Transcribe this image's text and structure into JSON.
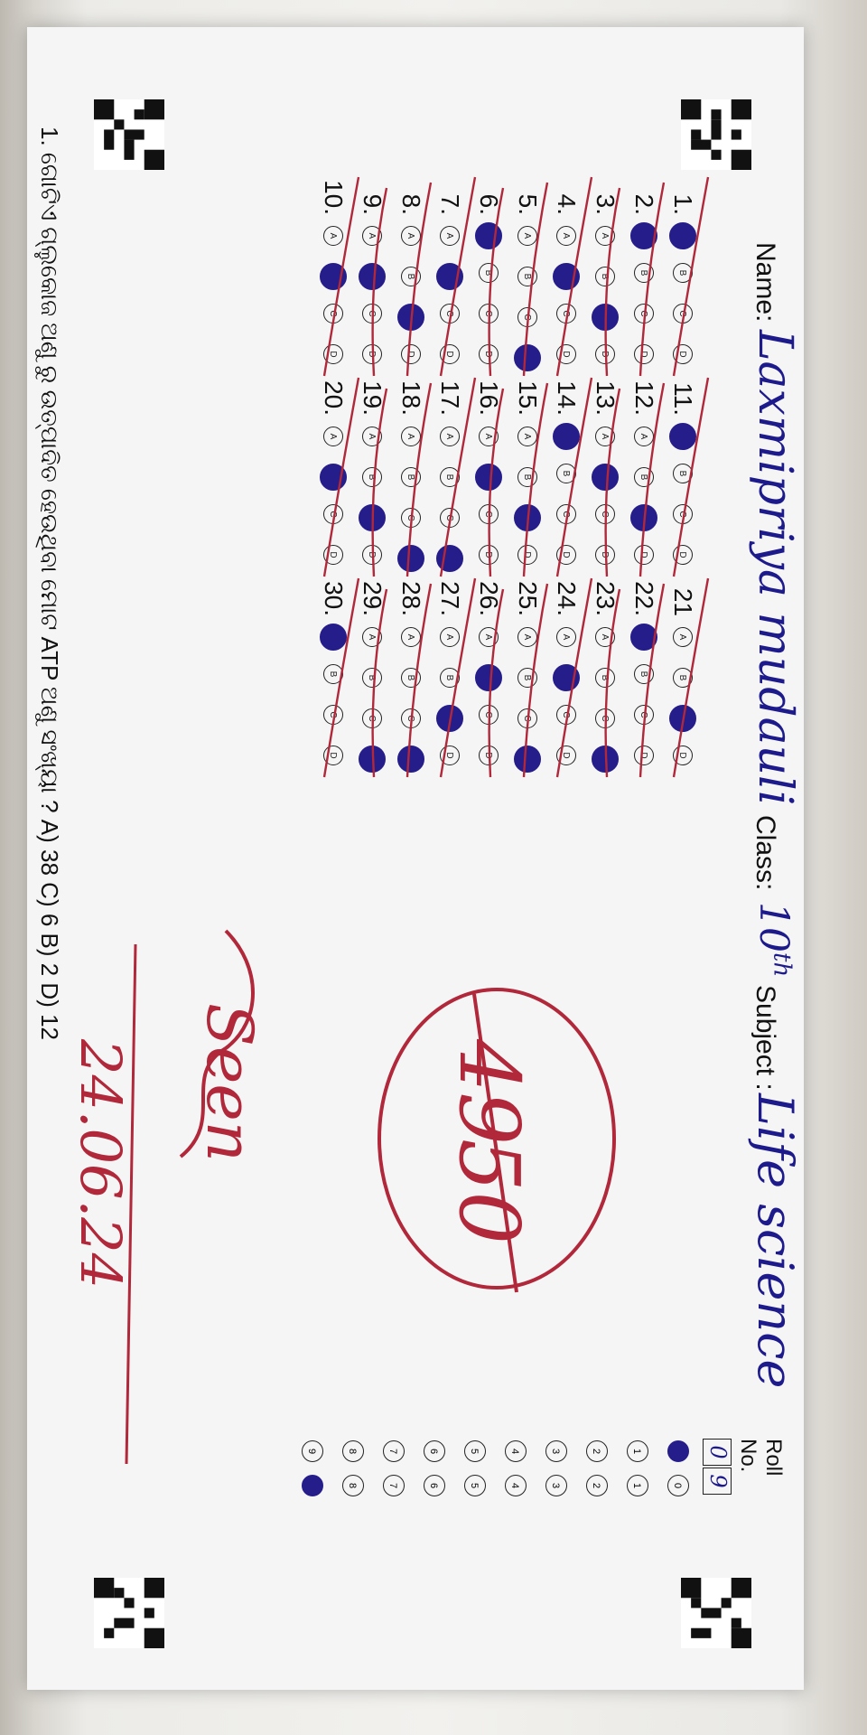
{
  "header": {
    "name_label": "Name:",
    "name_value": "Laxmipriya mudauli",
    "class_label": "Class:",
    "class_value": "10",
    "class_sup": "th",
    "subject_label": "Subject :",
    "subject_value": "Life science",
    "roll_label": "Roll No."
  },
  "roll_number": [
    "0",
    "9"
  ],
  "roll_digits": [
    "0",
    "1",
    "2",
    "3",
    "4",
    "5",
    "6",
    "7",
    "8",
    "9"
  ],
  "options": [
    "A",
    "B",
    "C",
    "D"
  ],
  "answers": [
    {
      "q": "1.",
      "filled": "A"
    },
    {
      "q": "2.",
      "filled": "A"
    },
    {
      "q": "3.",
      "filled": "C"
    },
    {
      "q": "4.",
      "filled": "B"
    },
    {
      "q": "5.",
      "filled": "D"
    },
    {
      "q": "6.",
      "filled": "A"
    },
    {
      "q": "7.",
      "filled": "B"
    },
    {
      "q": "8.",
      "filled": "C"
    },
    {
      "q": "9.",
      "filled": "B"
    },
    {
      "q": "10.",
      "filled": "B"
    },
    {
      "q": "11.",
      "filled": "A"
    },
    {
      "q": "12.",
      "filled": "C"
    },
    {
      "q": "13.",
      "filled": "B"
    },
    {
      "q": "14.",
      "filled": "A"
    },
    {
      "q": "15.",
      "filled": "C"
    },
    {
      "q": "16.",
      "filled": "B"
    },
    {
      "q": "17.",
      "filled": "D"
    },
    {
      "q": "18.",
      "filled": "D"
    },
    {
      "q": "19.",
      "filled": "C"
    },
    {
      "q": "20.",
      "filled": "B"
    },
    {
      "q": "21",
      "filled": "C"
    },
    {
      "q": "22.",
      "filled": "A"
    },
    {
      "q": "23.",
      "filled": "D"
    },
    {
      "q": "24.",
      "filled": "B"
    },
    {
      "q": "25.",
      "filled": "D"
    },
    {
      "q": "26.",
      "filled": "B"
    },
    {
      "q": "27.",
      "filled": "C"
    },
    {
      "q": "28.",
      "filled": "D"
    },
    {
      "q": "29.",
      "filled": "D"
    },
    {
      "q": "30.",
      "filled": "A"
    }
  ],
  "score": {
    "obtained": "49",
    "total": "50"
  },
  "remark": "Seen",
  "date": "24.06.24",
  "question_strip": "1. ଗୋଟିଏ ଗ୍ଲୁକୋଜ ଅଣୁ ରୁ ଉତ୍ପାଦିତ ହେଉଥିବା ମୋଟ ATP ଅଣୁ ସଂଖ୍ୟା ?   A) 38   C) 6   B) 2   D) 12",
  "colors": {
    "ink": "#241d8a",
    "red_pen": "#b0283a",
    "paper": "#f5f5f5"
  }
}
